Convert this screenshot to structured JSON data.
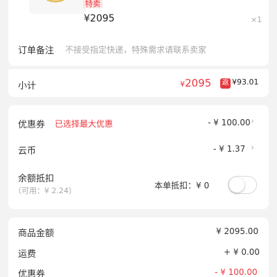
{
  "product": {
    "tag": "特卖",
    "price": "¥2095",
    "quantity": "×1",
    "image_icon": "gold-ring-image"
  },
  "remark": {
    "label": "订单备注",
    "placeholder": "不接受指定快递，特殊需求请联系卖家"
  },
  "subtotal": {
    "label": "小计",
    "currency": "¥",
    "amount": "2095",
    "rebate_badge": "返",
    "rebate": "¥93.01"
  },
  "discounts": {
    "coupon_label": "优惠券",
    "coupon_note": "已选择最大优惠",
    "coupon_value": "- ¥ 100.00",
    "coins_label": "云币",
    "coins_value": "- ¥ 1.37",
    "balance_label": "余额抵扣",
    "balance_available": "（可用：¥ 2.24）",
    "balance_deduct_label": "本单抵扣：¥ 0",
    "balance_toggle_on": false
  },
  "summary": {
    "goods_label": "商品金额",
    "goods_value": "¥ 2095.00",
    "shipping_label": "运费",
    "shipping_value": "+ ¥ 0.00",
    "coupon_label": "优惠券",
    "coupon_value": "- ¥ 100.00"
  },
  "colors": {
    "accent": "#e8373f",
    "background": "#f3f3f3",
    "card": "#ffffff"
  }
}
